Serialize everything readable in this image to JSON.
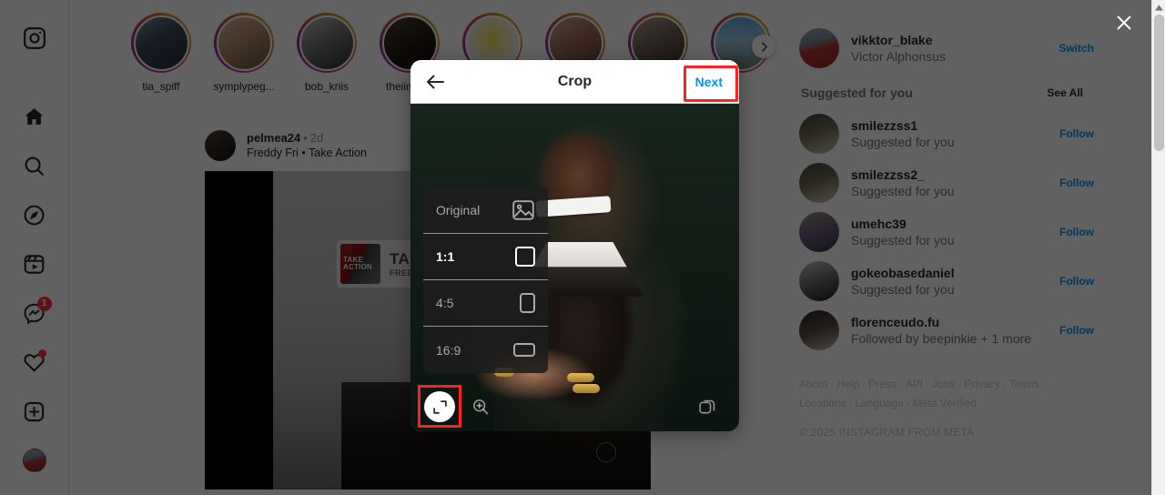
{
  "nav": {
    "logo_icon": "instagram-logo-icon",
    "items": [
      {
        "name": "home",
        "icon": "home-icon",
        "badge": ""
      },
      {
        "name": "search",
        "icon": "search-icon",
        "badge": ""
      },
      {
        "name": "explore",
        "icon": "compass-icon",
        "badge": ""
      },
      {
        "name": "reels",
        "icon": "reels-icon",
        "badge": ""
      },
      {
        "name": "messages",
        "icon": "messenger-icon",
        "badge": "1"
      },
      {
        "name": "notifications",
        "icon": "heart-icon",
        "badge": "dot"
      },
      {
        "name": "create",
        "icon": "plus-square-icon",
        "badge": ""
      },
      {
        "name": "profile",
        "icon": "avatar-icon",
        "badge": ""
      }
    ]
  },
  "stories": {
    "next_icon": "chevron-right-icon",
    "items": [
      {
        "username": "tia_spiff"
      },
      {
        "username": "symplypeg..."
      },
      {
        "username": "bob_kriis"
      },
      {
        "username": "theiimanb"
      },
      {
        "username": ""
      },
      {
        "username": ""
      },
      {
        "username": ""
      },
      {
        "username": ""
      }
    ]
  },
  "post": {
    "username": "pelmea24",
    "separator": "•",
    "time": "2d",
    "audio": "Freddy Fri • Take Action",
    "music_card": {
      "title": "TAKE AC",
      "artist": "FREDDY FR",
      "art_line1": "TAKE",
      "art_line2": "ACTION",
      "note_icon": "music-note-icon"
    },
    "play_icon": "play-triangle-icon"
  },
  "sidebar": {
    "account": {
      "username": "vikktor_blake",
      "fullname": "Victor Alphonsus",
      "action": "Switch"
    },
    "suggested_header": {
      "title": "Suggested for you",
      "see_all": "See All"
    },
    "suggestions": [
      {
        "username": "smilezzss1",
        "subtitle": "Suggested for you",
        "action": "Follow"
      },
      {
        "username": "smilezzss2_",
        "subtitle": "Suggested for you",
        "action": "Follow"
      },
      {
        "username": "umehc39",
        "subtitle": "Suggested for you",
        "action": "Follow"
      },
      {
        "username": "gokeobasedaniel",
        "subtitle": "Suggested for you",
        "action": "Follow"
      },
      {
        "username": "florenceudo.fu",
        "subtitle": "Followed by beepinkie + 1 more",
        "action": "Follow"
      }
    ],
    "footer": {
      "links": [
        "About",
        "Help",
        "Press",
        "API",
        "Jobs",
        "Privacy",
        "Terms",
        "Locations",
        "Language",
        "Meta Verified"
      ],
      "separator": "·",
      "copyright": "© 2025 INSTAGRAM FROM META"
    }
  },
  "modal": {
    "title": "Crop",
    "back_icon": "arrow-left-icon",
    "next_label": "Next",
    "ratios": [
      {
        "label": "Original",
        "icon": "image-icon",
        "selected": false
      },
      {
        "label": "1:1",
        "icon": "square-icon",
        "selected": true
      },
      {
        "label": "4:5",
        "icon": "portrait-icon",
        "selected": false
      },
      {
        "label": "16:9",
        "icon": "landscape-icon",
        "selected": false
      }
    ],
    "tools": {
      "expand_icon": "expand-crop-icon",
      "zoom_icon": "zoom-in-icon",
      "layers_icon": "select-multiple-icon"
    }
  },
  "overlay": {
    "close_icon": "close-icon"
  },
  "colors": {
    "accent": "#0095f6",
    "highlight": "#ff2020",
    "badge": "#ff3040"
  }
}
